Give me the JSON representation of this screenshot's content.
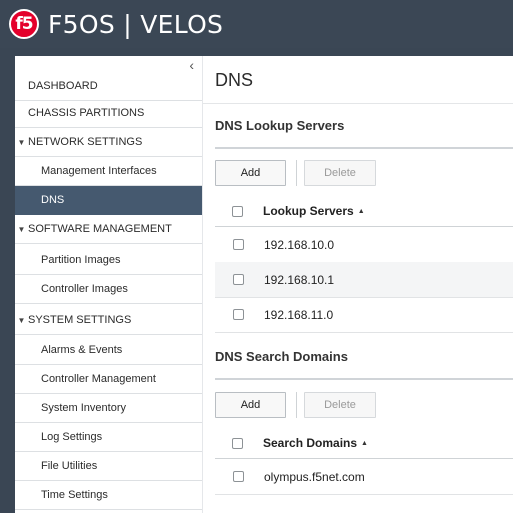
{
  "header": {
    "logo_text": "f5",
    "product": "F5OS | VELOS"
  },
  "sidebar": {
    "collapse_glyph": "‹",
    "items": [
      {
        "label": "DASHBOARD"
      },
      {
        "label": "CHASSIS PARTITIONS"
      },
      {
        "label": "NETWORK SETTINGS"
      },
      {
        "label": "Management Interfaces"
      },
      {
        "label": "DNS"
      },
      {
        "label": "SOFTWARE MANAGEMENT"
      },
      {
        "label": "Partition Images"
      },
      {
        "label": "Controller Images"
      },
      {
        "label": "SYSTEM SETTINGS"
      },
      {
        "label": "Alarms & Events"
      },
      {
        "label": "Controller Management"
      },
      {
        "label": "System Inventory"
      },
      {
        "label": "Log Settings"
      },
      {
        "label": "File Utilities"
      },
      {
        "label": "Time Settings"
      }
    ]
  },
  "main": {
    "title": "DNS",
    "lookup": {
      "section_title": "DNS Lookup Servers",
      "add_label": "Add",
      "delete_label": "Delete",
      "column_header": "Lookup Servers",
      "rows": [
        "192.168.10.0",
        "192.168.10.1",
        "192.168.11.0"
      ]
    },
    "search": {
      "section_title": "DNS Search Domains",
      "add_label": "Add",
      "delete_label": "Delete",
      "column_header": "Search Domains",
      "rows": [
        "olympus.f5net.com"
      ]
    }
  },
  "colors": {
    "header_bg": "#3b4755",
    "active_nav": "#45596f",
    "logo_red": "#e4002b"
  }
}
